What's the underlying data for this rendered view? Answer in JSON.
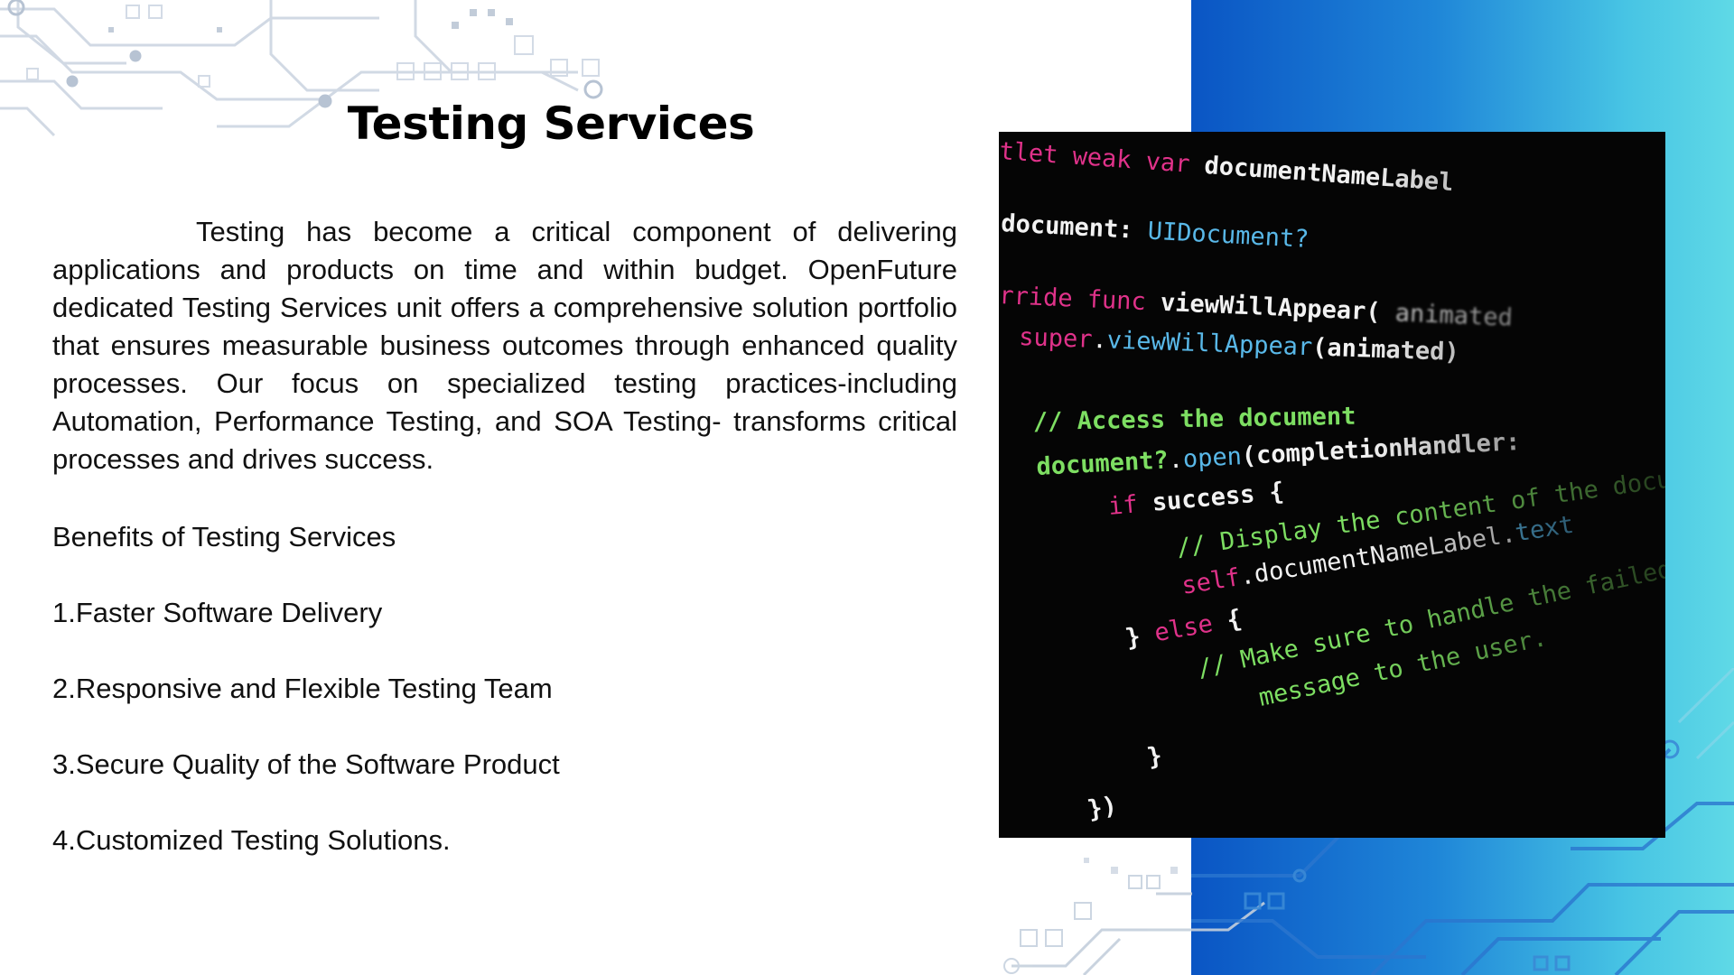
{
  "slide": {
    "title": "Testing Services",
    "paragraph": "Testing has become a critical component of delivering applications and products on time and within budget. OpenFuture dedicated Testing Services unit offers a comprehensive solution portfolio that ensures measurable business outcomes through enhanced quality processes. Our focus on specialized testing practices-including Automation, Performance Testing, and SOA Testing- transforms critical processes and drives success.",
    "benefits_heading": "Benefits of Testing Services",
    "benefits": [
      "1.Faster Software Delivery",
      "2.Responsive and Flexible Testing Team",
      "3.Secure Quality of the Software Product",
      "4.Customized Testing Solutions."
    ]
  },
  "code_image": {
    "lines": [
      "tlet weak var documentNameLabel",
      "document: UIDocument?",
      "rride func viewWillAppear( animated",
      "super.viewWillAppear(animated)",
      "// Access the document",
      "document?.open(completionHandler:",
      "if success {",
      "// Display the content of the document",
      "self.documentNameLabel.text",
      "} else {",
      "// Make sure to handle the failed import",
      "message to the user.",
      "}",
      "})"
    ]
  },
  "colors": {
    "gradient_start": "#0a55c4",
    "gradient_end": "#5fd9e6",
    "keyword": "#e0328a",
    "type": "#59b8e8",
    "comment": "#7dde62",
    "plain": "#f2f2f2"
  }
}
